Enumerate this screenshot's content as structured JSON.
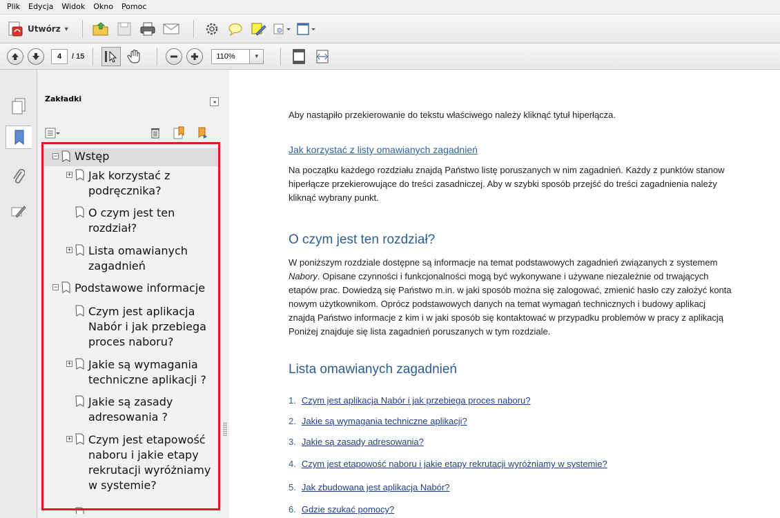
{
  "menu": [
    "Plik",
    "Edycja",
    "Widok",
    "Okno",
    "Pomoc"
  ],
  "toolbar1": {
    "create_label": "Utwórz"
  },
  "toolbar2": {
    "page_current": "4",
    "page_total": "/ 15",
    "zoom": "110%"
  },
  "panel": {
    "title": "Zakładki",
    "bookmarks": [
      {
        "label": [
          "Wstęp"
        ],
        "expander": "minus",
        "level": 0,
        "selected": true
      },
      {
        "label": [
          "Jak korzystać z",
          "podręcznika?"
        ],
        "expander": "plus",
        "level": 1
      },
      {
        "label": [
          "O czym jest ten",
          "rozdział?"
        ],
        "expander": "none",
        "level": 1
      },
      {
        "label": [
          "Lista omawianych",
          "zagadnień"
        ],
        "expander": "plus",
        "level": 1
      },
      {
        "label": [
          "Podstawowe informacje"
        ],
        "expander": "minus",
        "level": 0
      },
      {
        "label": [
          "Czym jest aplikacja",
          "Nabór i jak przebiega",
          "proces naboru?"
        ],
        "expander": "none",
        "level": 1
      },
      {
        "label": [
          "Jakie są wymagania",
          "techniczne aplikacji ?"
        ],
        "expander": "plus",
        "level": 1
      },
      {
        "label": [
          "Jakie są zasady",
          "adresowania ?"
        ],
        "expander": "none",
        "level": 1
      },
      {
        "label": [
          "Czym jest etapowość",
          "naboru i jakie etapy",
          "rekrutacji wyróżniamy",
          "w systemie?"
        ],
        "expander": "plus",
        "level": 1
      }
    ]
  },
  "document": {
    "lead": "Aby nastąpiło przekierowanie do tekstu właściwego należy kliknąć tytuł hiperłącza.",
    "sublink": "Jak korzystać z listy omawianych zagadnień",
    "para1": [
      "Na początku każdego rozdziału znajdą Państwo listę poruszanych w nim zagadnień. Każdy z punktów stanow",
      "hiperłącze przekierowujące do treści zasadniczej. Aby w szybki sposób przejść do treści zagadnienia należy",
      "kliknąć wybrany punkt."
    ],
    "heading1": "O czym jest ten rozdział?",
    "para2": [
      "W poniższym rozdziale dostępne są informacje na temat podstawowych zagadnień związanych z systemem",
      "Nabory. Opisane czynności i funkcjonalności mogą być wykonywane i używane niezależnie od trwających",
      "etapów prac. Dowiedzą się Państwo m.in. w jaki sposób można się zalogować, zmienić hasło czy założyć konta",
      "nowym użytkownikom. Oprócz podstawowych danych na temat wymagań technicznych i budowy aplikacj",
      "znajdą Państwo informacje z kim i w jaki sposób się kontaktować w przypadku problemów w pracy z aplikacją",
      "Poniżej znajduje się lista zagadnień poruszanych w tym rozdziale."
    ],
    "para2_italic": "Nabory",
    "heading2": "Lista omawianych zagadnień",
    "list": [
      {
        "num": "1.",
        "text": "Czym jest aplikacja Nabór i jak przebiega proces naboru?"
      },
      {
        "num": "2.",
        "text": "Jakie są wymagania techniczne aplikacji?"
      },
      {
        "num": "3.",
        "text": "Jakie są zasady adresowania?"
      },
      {
        "num": "4.",
        "text": "Czym jest etapowość naboru i jakie etapy rekrutacji wyróżniamy w systemie?"
      },
      {
        "num": "5.",
        "text": "Jak zbudowana jest aplikacja Nabór?"
      },
      {
        "num": "6.",
        "text": "Gdzie szukać pomocy?"
      }
    ]
  },
  "colors": {
    "highlight": "#e2191e",
    "heading": "#2a5d91",
    "link": "#1f3f8c"
  }
}
